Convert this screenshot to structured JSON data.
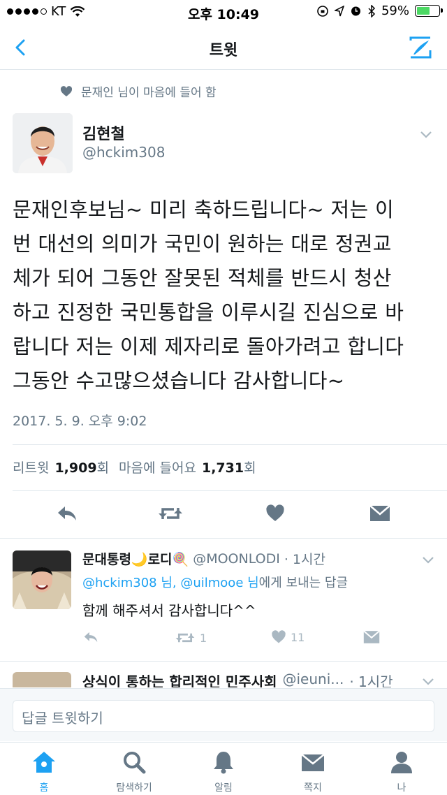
{
  "status_bar": {
    "carrier": "KT",
    "time": "오후 10:49",
    "battery_percent": "59%",
    "battery_level": 0.59
  },
  "nav": {
    "title": "트윗",
    "back_icon": "chevron-left-icon",
    "compose_icon": "compose-tweet-icon"
  },
  "liked_by": {
    "text": "문재인 님이 마음에 들어 함"
  },
  "tweet": {
    "author_name": "김현철",
    "author_handle": "@hckim308",
    "text": "문재인후보님~  미리 축하드립니다~ 저는 이\n번 대선의 의미가 국민이 원하는 대로 정권교\n체가 되어 그동안 잘못된 적체를 반드시 청산\n하고 진정한 국민통합을 이루시길 진심으로 바\n랍니다 저는 이제 제자리로 돌아가려고 합니다\n그동안 수고많으셨습니다 감사합니다~",
    "timestamp": "2017. 5. 9. 오후 9:02",
    "stats": {
      "retweet_label": "리트윗",
      "retweet_count": "1,909",
      "retweet_unit": "회",
      "like_label": "마음에 들어요",
      "like_count": "1,731",
      "like_unit": "회"
    }
  },
  "reply": {
    "name": "문대통령🌙로디🍭",
    "handle": "@MOONLODI",
    "time": "· 1시간",
    "to_mention_1": "@hckim308 님, @uilmooe 님",
    "to_suffix": "에게 보내는 답글",
    "text": "함께 해주셔서 감사합니다^^",
    "retweet_count": "1",
    "like_count": "11"
  },
  "next_tweet": {
    "name": "상식이 통하는 합리적인 민주사회",
    "handle": "@ieuni...",
    "time": "· 1시간"
  },
  "composer": {
    "placeholder": "답글 트윗하기"
  },
  "tabs": [
    {
      "label": "홈",
      "icon": "home-icon",
      "active": true
    },
    {
      "label": "탐색하기",
      "icon": "search-icon",
      "active": false
    },
    {
      "label": "알림",
      "icon": "bell-icon",
      "active": false
    },
    {
      "label": "쪽지",
      "icon": "envelope-icon",
      "active": false
    },
    {
      "label": "나",
      "icon": "person-icon",
      "active": false
    }
  ],
  "colors": {
    "accent": "#1da1f2",
    "muted": "#657786",
    "action_gray": "#aab8c2"
  }
}
